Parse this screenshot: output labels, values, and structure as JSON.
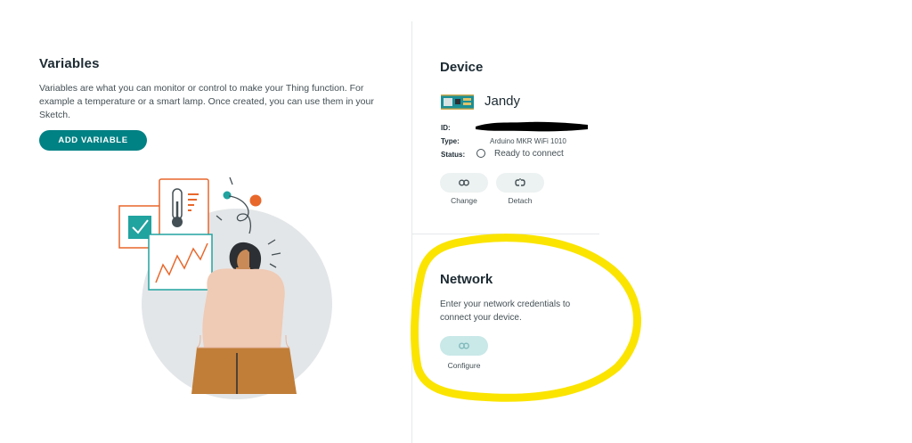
{
  "variables": {
    "title": "Variables",
    "description": "Variables are what you can monitor or control to make your Thing function. For example a temperature or a smart lamp. Once created, you can use them in your Sketch.",
    "add_button_label": "ADD VARIABLE"
  },
  "device": {
    "title": "Device",
    "name": "Jandy",
    "id_label": "ID:",
    "type_label": "Type:",
    "type_value": "Arduino MKR WiFi 1010",
    "status_label": "Status:",
    "status_value": "Ready to connect",
    "change_label": "Change",
    "detach_label": "Detach"
  },
  "network": {
    "title": "Network",
    "description": "Enter your network credentials to connect your device.",
    "configure_label": "Configure"
  },
  "colors": {
    "accent": "#008184",
    "highlight": "#fbe400",
    "orange": "#e8672b"
  },
  "icons": [
    "link-icon",
    "unlink-icon",
    "board-icon",
    "checkbox-icon",
    "thermometer-icon",
    "chart-icon"
  ]
}
